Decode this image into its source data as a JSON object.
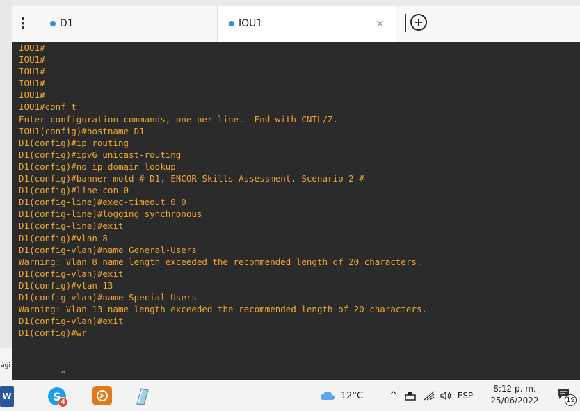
{
  "side_fragment": "ági",
  "tabs": [
    {
      "label": "D1",
      "active": false
    },
    {
      "label": "IOU1",
      "active": true
    }
  ],
  "tab_close_glyph": "×",
  "add_tab_glyph": "+",
  "menu_glyph": "⋮",
  "terminal": {
    "lines": [
      "IOU1#",
      "IOU1#",
      "IOU1#",
      "IOU1#",
      "IOU1#",
      "IOU1#conf t",
      "Enter configuration commands, one per line.  End with CNTL/Z.",
      "IOU1(config)#hostname D1",
      "D1(config)#ip routing",
      "D1(config)#ipv6 unicast-routing",
      "D1(config)#no ip domain lookup",
      "D1(config)#banner motd # D1, ENCOR Skills Assessment, Scenario 2 #",
      "D1(config)#line con 0",
      "D1(config-line)#exec-timeout 0 0",
      "D1(config-line)#logging synchronous",
      "D1(config-line)#exit",
      "D1(config)#vlan 8",
      "D1(config-vlan)#name General-Users",
      "Warning: Vlan 8 name length exceeded the recommended length of 20 characters.",
      "D1(config-vlan)#exit",
      "D1(config)#vlan 13",
      "D1(config-vlan)#name Special-Users",
      "Warning: Vlan 13 name length exceeded the recommended length of 20 characters.",
      "D1(config-vlan)#exit",
      "D1(config)#wr"
    ],
    "caret": "^"
  },
  "taskbar": {
    "word_label": "W",
    "skype_letter": "S",
    "skype_badge": "4",
    "weather": "12°C",
    "language": "ESP",
    "time": "8:12 p. m.",
    "date": "25/06/2022",
    "notification_count": "19"
  },
  "colors": {
    "terminal_bg": "#2b2b2b",
    "terminal_text": "#f0a830",
    "tab_dot": "#2f8fe6"
  }
}
